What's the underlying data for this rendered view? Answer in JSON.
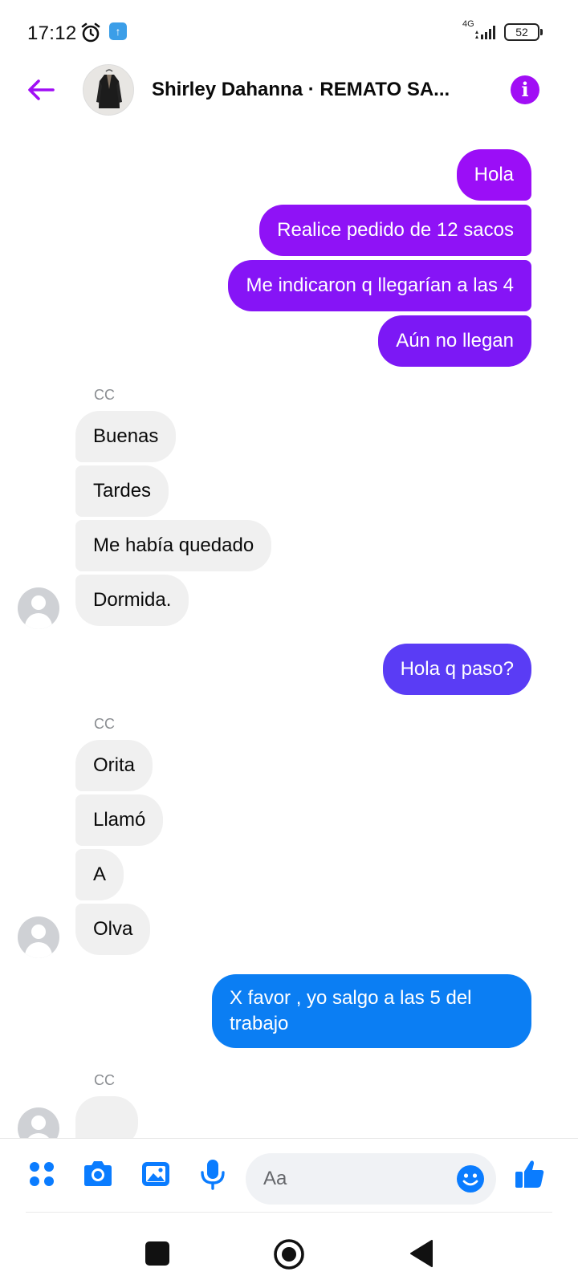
{
  "status_bar": {
    "time": "17:12",
    "network": "4G",
    "battery": "52"
  },
  "header": {
    "title": "Shirley Dahanna · REMATO SA..."
  },
  "thread": {
    "group1_out": [
      "Hola",
      "Realice pedido de 12 sacos",
      "Me indicaron q llegarían a las 4",
      "Aún no llegan"
    ],
    "group2_sender": "CC",
    "group2_in": [
      "Buenas",
      "Tardes",
      "Me había quedado",
      "Dormida."
    ],
    "group3_out": [
      "Hola q paso?"
    ],
    "group4_sender": "CC",
    "group4_in": [
      "Orita",
      "Llamó",
      "A",
      "Olva"
    ],
    "group5_out_line1": "X favor , yo salgo a las 5 del",
    "group5_out_line2": "trabajo",
    "group6_sender": "CC"
  },
  "composer": {
    "placeholder": "Aa"
  },
  "colors": {
    "accent": "#a10ef5",
    "bubble_gradient_top": "#9b0ef7",
    "bubble_gradient_mid": "#5a3cf5",
    "bubble_gradient_bottom": "#0b7ef3",
    "incoming_bubble": "#f0f0f0",
    "composer_icon": "#0a7cff"
  },
  "icons": {
    "back": "arrow-left-icon",
    "info": "info-icon",
    "menu": "four-dots-icon",
    "camera": "camera-icon",
    "gallery": "image-icon",
    "mic": "microphone-icon",
    "emoji": "smiley-icon",
    "like": "thumbs-up-icon"
  }
}
